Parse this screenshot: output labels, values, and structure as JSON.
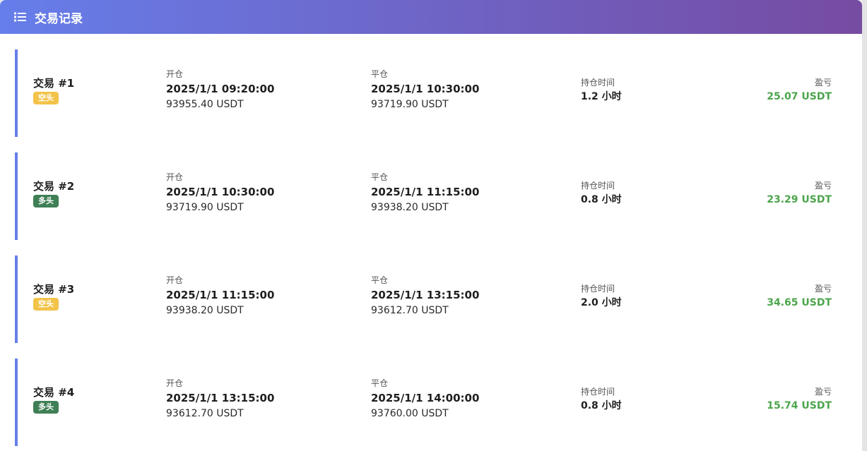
{
  "header": {
    "title": "交易记录",
    "icon": "list-icon"
  },
  "labels": {
    "open": "开仓",
    "close": "平仓",
    "hold": "持仓时间",
    "pnl": "盈亏"
  },
  "colors": {
    "header_gradient_start": "#667eea",
    "header_gradient_end": "#764ba2",
    "row_accent": "#667eea",
    "short_badge": "#f3c34a",
    "long_badge": "#3f7f55",
    "profit": "#4ca54c"
  },
  "trades": [
    {
      "name": "交易 #1",
      "side": "空头",
      "side_type": "short",
      "open_time": "2025/1/1 09:20:00",
      "open_price": "93955.40 USDT",
      "close_time": "2025/1/1 10:30:00",
      "close_price": "93719.90 USDT",
      "hold": "1.2 小时",
      "pnl": "25.07 USDT"
    },
    {
      "name": "交易 #2",
      "side": "多头",
      "side_type": "long",
      "open_time": "2025/1/1 10:30:00",
      "open_price": "93719.90 USDT",
      "close_time": "2025/1/1 11:15:00",
      "close_price": "93938.20 USDT",
      "hold": "0.8 小时",
      "pnl": "23.29 USDT"
    },
    {
      "name": "交易 #3",
      "side": "空头",
      "side_type": "short",
      "open_time": "2025/1/1 11:15:00",
      "open_price": "93938.20 USDT",
      "close_time": "2025/1/1 13:15:00",
      "close_price": "93612.70 USDT",
      "hold": "2.0 小时",
      "pnl": "34.65 USDT"
    },
    {
      "name": "交易 #4",
      "side": "多头",
      "side_type": "long",
      "open_time": "2025/1/1 13:15:00",
      "open_price": "93612.70 USDT",
      "close_time": "2025/1/1 14:00:00",
      "close_price": "93760.00 USDT",
      "hold": "0.8 小时",
      "pnl": "15.74 USDT"
    }
  ]
}
